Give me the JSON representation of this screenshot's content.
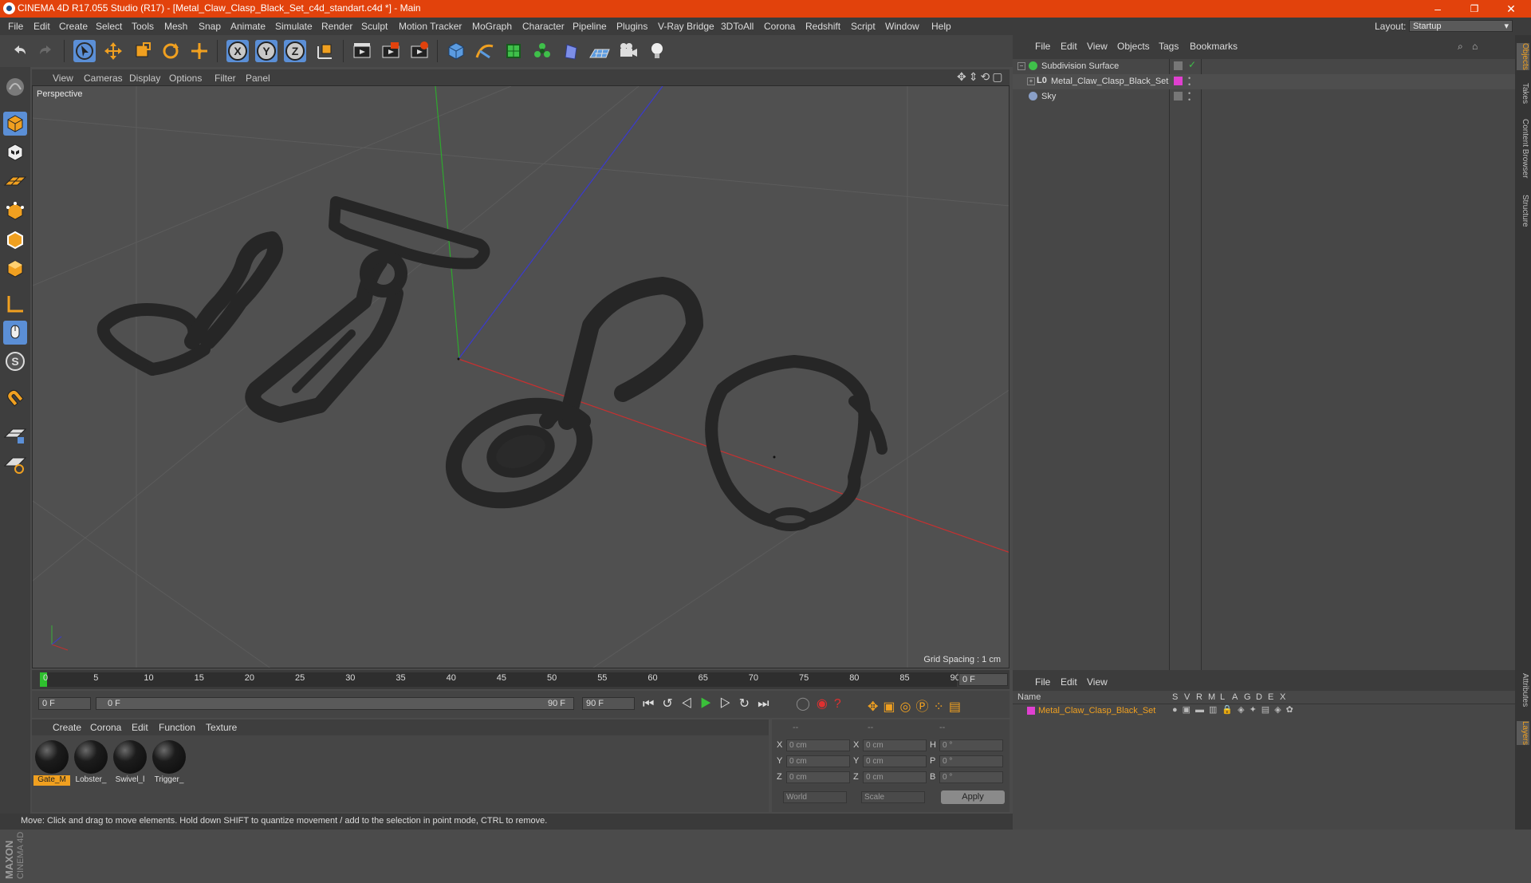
{
  "app": {
    "title": "CINEMA 4D R17.055 Studio (R17) - [Metal_Claw_Clasp_Black_Set_c4d_standart.c4d *] - Main",
    "window_controls": {
      "minimize": "–",
      "restore": "❐",
      "close": "✕"
    }
  },
  "menubar": {
    "items": [
      "File",
      "Edit",
      "Create",
      "Select",
      "Tools",
      "Mesh",
      "Snap",
      "Animate",
      "Simulate",
      "Render",
      "Sculpt",
      "Motion Tracker",
      "MoGraph",
      "Character",
      "Pipeline",
      "Plugins",
      "V-Ray Bridge",
      "3DToAll",
      "Corona",
      "Redshift",
      "Script",
      "Window",
      "Help"
    ],
    "layout_label": "Layout:",
    "layout_value": "Startup"
  },
  "toolbar": {
    "icons": [
      "undo-icon",
      "redo-icon",
      "select-arrow-icon",
      "move-icon",
      "scale-icon",
      "rotate-icon",
      "live-select-icon",
      "x-axis-icon",
      "y-axis-icon",
      "z-axis-icon",
      "world-coord-icon",
      "render-view-icon",
      "render-picture-viewer-icon",
      "render-settings-icon",
      "cube-primitive-icon",
      "pen-spline-icon",
      "subdivision-generator-icon",
      "cloner-icon",
      "deformer-icon",
      "floor-icon",
      "camera-icon",
      "light-icon"
    ],
    "axis_labels": {
      "x": "X",
      "y": "Y",
      "z": "Z"
    }
  },
  "viewport": {
    "menu": [
      "View",
      "Cameras",
      "Display",
      "Options",
      "Filter",
      "Panel"
    ],
    "label": "Perspective",
    "grid_spacing": "Grid Spacing : 1 cm"
  },
  "timeline": {
    "ticks": [
      "0",
      "5",
      "10",
      "15",
      "20",
      "25",
      "30",
      "35",
      "40",
      "45",
      "50",
      "55",
      "60",
      "65",
      "70",
      "75",
      "80",
      "85",
      "90"
    ],
    "current_frame": "0 F",
    "start_field": "0 F",
    "slider_start": "0 F",
    "slider_end": "90 F",
    "end_field": "90 F"
  },
  "material_manager": {
    "menu": [
      "Create",
      "Corona",
      "Edit",
      "Function",
      "Texture"
    ],
    "materials": [
      {
        "label": "Gate_M",
        "selected": true
      },
      {
        "label": "Lobster_",
        "selected": false
      },
      {
        "label": "Swivel_l",
        "selected": false
      },
      {
        "label": "Trigger_",
        "selected": false
      }
    ]
  },
  "coordinates": {
    "header": [
      "--",
      "--",
      "--"
    ],
    "rows": [
      {
        "l1": "X",
        "v1": "0 cm",
        "l2": "X",
        "v2": "0 cm",
        "l3": "H",
        "v3": "0 °"
      },
      {
        "l1": "Y",
        "v1": "0 cm",
        "l2": "Y",
        "v2": "0 cm",
        "l3": "P",
        "v3": "0 °"
      },
      {
        "l1": "Z",
        "v1": "0 cm",
        "l2": "Z",
        "v2": "0 cm",
        "l3": "B",
        "v3": "0 °"
      }
    ],
    "mode_world": "World",
    "mode_scale": "Scale",
    "apply": "Apply"
  },
  "object_manager": {
    "menu": [
      "File",
      "Edit",
      "View",
      "Objects",
      "Tags",
      "Bookmarks"
    ],
    "objects": [
      {
        "name": "Subdivision Surface",
        "icon": "subdivision-icon",
        "color": "#3fc04a"
      },
      {
        "name": "Metal_Claw_Clasp_Black_Set",
        "icon": "null-object-icon",
        "color": "#e040d0"
      },
      {
        "name": "Sky",
        "icon": "sky-icon",
        "color": "#8aa0c8"
      }
    ]
  },
  "layer_manager": {
    "menu": [
      "File",
      "Edit",
      "View"
    ],
    "columns": [
      "Name",
      "S",
      "V",
      "R",
      "M",
      "L",
      "A",
      "G",
      "D",
      "E",
      "X"
    ],
    "layers": [
      {
        "name": "Metal_Claw_Clasp_Black_Set",
        "color": "#e040d0"
      }
    ]
  },
  "status": {
    "text": "Move: Click and drag to move elements. Hold down SHIFT to quantize movement / add to the selection in point mode, CTRL to remove."
  },
  "right_tabs": [
    "Objects",
    "Takes",
    "Content Browser",
    "Structure",
    "Attributes",
    "Layers"
  ],
  "branding": {
    "logo_text": "MAXON CINEMA 4D"
  },
  "colors": {
    "accent": "#e2420c",
    "selected_label": "#f0a020",
    "active_blue": "#5b8fd6"
  }
}
